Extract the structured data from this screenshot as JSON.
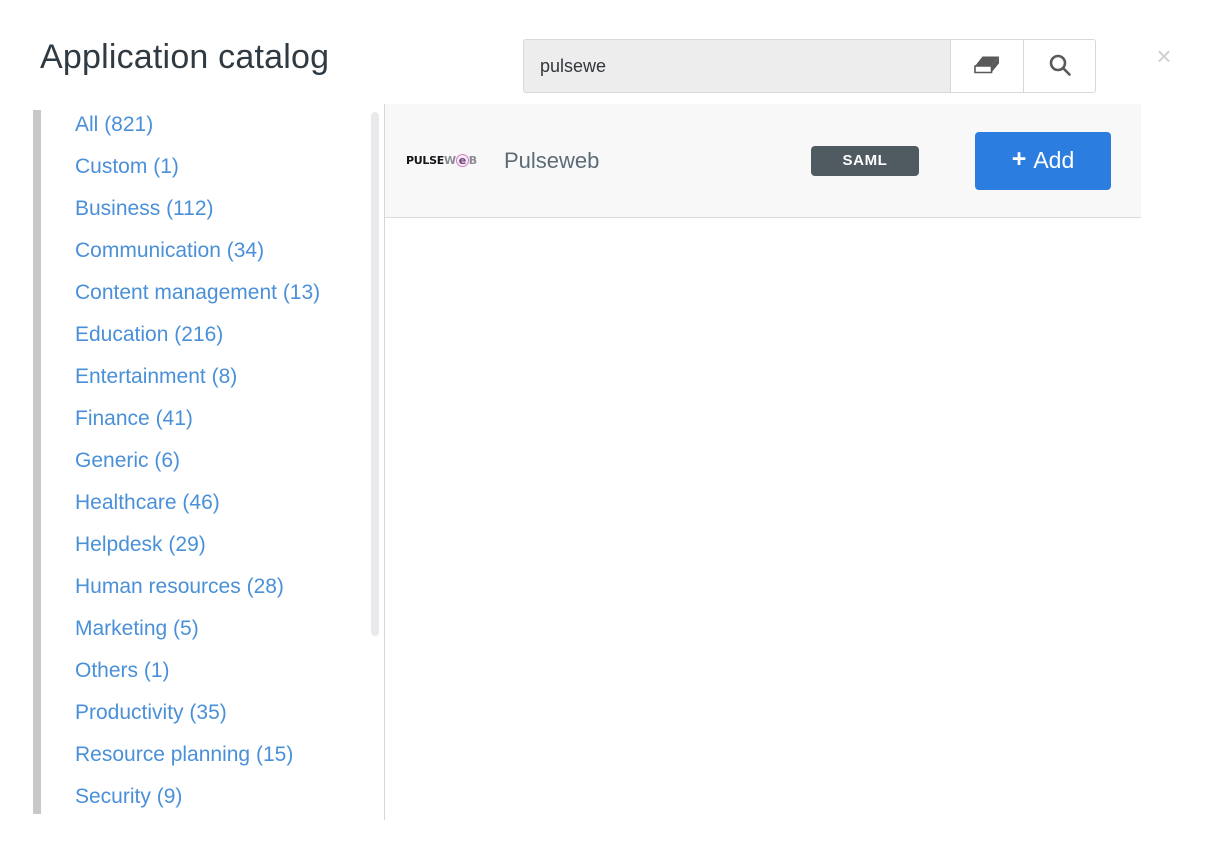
{
  "header": {
    "title": "Application catalog",
    "close_label": "×"
  },
  "search": {
    "value": "pulsewe",
    "placeholder": "",
    "clear_icon": "eraser-icon",
    "submit_icon": "search-icon"
  },
  "sidebar": {
    "items": [
      {
        "label": "All",
        "count": "(821)"
      },
      {
        "label": "Custom",
        "count": "(1)"
      },
      {
        "label": "Business",
        "count": "(112)"
      },
      {
        "label": "Communication",
        "count": "(34)"
      },
      {
        "label": "Content management",
        "count": "(13)"
      },
      {
        "label": "Education",
        "count": "(216)"
      },
      {
        "label": "Entertainment",
        "count": "(8)"
      },
      {
        "label": "Finance",
        "count": "(41)"
      },
      {
        "label": "Generic",
        "count": "(6)"
      },
      {
        "label": "Healthcare",
        "count": "(46)"
      },
      {
        "label": "Helpdesk",
        "count": "(29)"
      },
      {
        "label": "Human resources",
        "count": "(28)"
      },
      {
        "label": "Marketing",
        "count": "(5)"
      },
      {
        "label": "Others",
        "count": "(1)"
      },
      {
        "label": "Productivity",
        "count": "(35)"
      },
      {
        "label": "Resource planning",
        "count": "(15)"
      },
      {
        "label": "Security",
        "count": "(9)"
      }
    ]
  },
  "results": [
    {
      "logo": {
        "part1": "PULSE",
        "part2": "W",
        "part3": "e",
        "part4": "B"
      },
      "name": "Pulseweb",
      "badge": "SAML",
      "add_label": "Add",
      "add_plus": "+"
    }
  ],
  "colors": {
    "accent_blue": "#2b7de0",
    "link_blue": "#4a90d9",
    "badge_gray": "#4f5b61",
    "title_dark": "#2f3a43",
    "row_bg": "#f8f8f8"
  }
}
